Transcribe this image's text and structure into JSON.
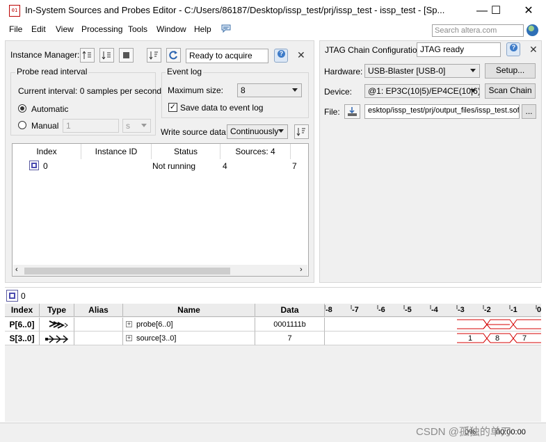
{
  "window": {
    "title": "In-System Sources and Probes Editor - C:/Users/86187/Desktop/issp_test/prj/issp_test - issp_test - [Sp...",
    "icon_text": "01",
    "minimize": "—",
    "maximize": "☐",
    "close": "✕"
  },
  "menu": [
    "File",
    "Edit",
    "View",
    "Processing",
    "Tools",
    "Window",
    "Help"
  ],
  "search": {
    "placeholder": "Search altera.com"
  },
  "instance_manager": {
    "label": "Instance Manager:",
    "status": "Ready to acquire",
    "probe_read_interval": {
      "title": "Probe read interval",
      "current_interval": "Current interval:  0 samples per second",
      "automatic": "Automatic",
      "manual": "Manual",
      "manual_value": "1",
      "manual_unit": "s"
    },
    "event_log": {
      "title": "Event log",
      "max_size_label": "Maximum size:",
      "max_size_value": "8",
      "save_label": "Save data to event log"
    },
    "write_source": {
      "label": "Write source data:",
      "value": "Continuously"
    },
    "table": {
      "columns": [
        "Index",
        "Instance ID",
        "Status",
        "Sources: 4",
        ""
      ],
      "rows": [
        {
          "index": "0",
          "instance_id": "",
          "status": "Not running",
          "sources": "4",
          "probes": "7"
        }
      ]
    }
  },
  "jtag": {
    "title": "JTAG Chain Configuration:",
    "status": "JTAG ready",
    "hardware_label": "Hardware:",
    "hardware_value": "USB-Blaster [USB-0]",
    "setup_button": "Setup...",
    "device_label": "Device:",
    "device_value": "@1: EP3C(10|5)/EP4CE(10|6)",
    "scan_button": "Scan Chain",
    "file_label": "File:",
    "file_value": "esktop/issp_test/prj/output_files/issp_test.sof",
    "browse_button": "..."
  },
  "instance_selector": {
    "value": "0"
  },
  "signals": {
    "columns": [
      "Index",
      "Type",
      "Alias",
      "Name",
      "Data"
    ],
    "ticks": [
      "-8",
      "-7",
      "-6",
      "-5",
      "-4",
      "-3",
      "-2",
      "-1",
      "0"
    ],
    "rows": [
      {
        "index": "P[6..0]",
        "type": "probe",
        "alias": "",
        "name": "probe[6..0]",
        "data": "0001111b",
        "wave": [
          "",
          "",
          ""
        ]
      },
      {
        "index": "S[3..0]",
        "type": "source",
        "alias": "",
        "name": "source[3..0]",
        "data": "7",
        "wave": [
          "1",
          "8",
          "7"
        ]
      }
    ]
  },
  "colors": {
    "wave": "#d40000",
    "accent": "#3d7bc8"
  },
  "status_bar": {
    "progress": "0%",
    "time": "00:00:00"
  },
  "watermark": "CSDN @孤独的单刀"
}
